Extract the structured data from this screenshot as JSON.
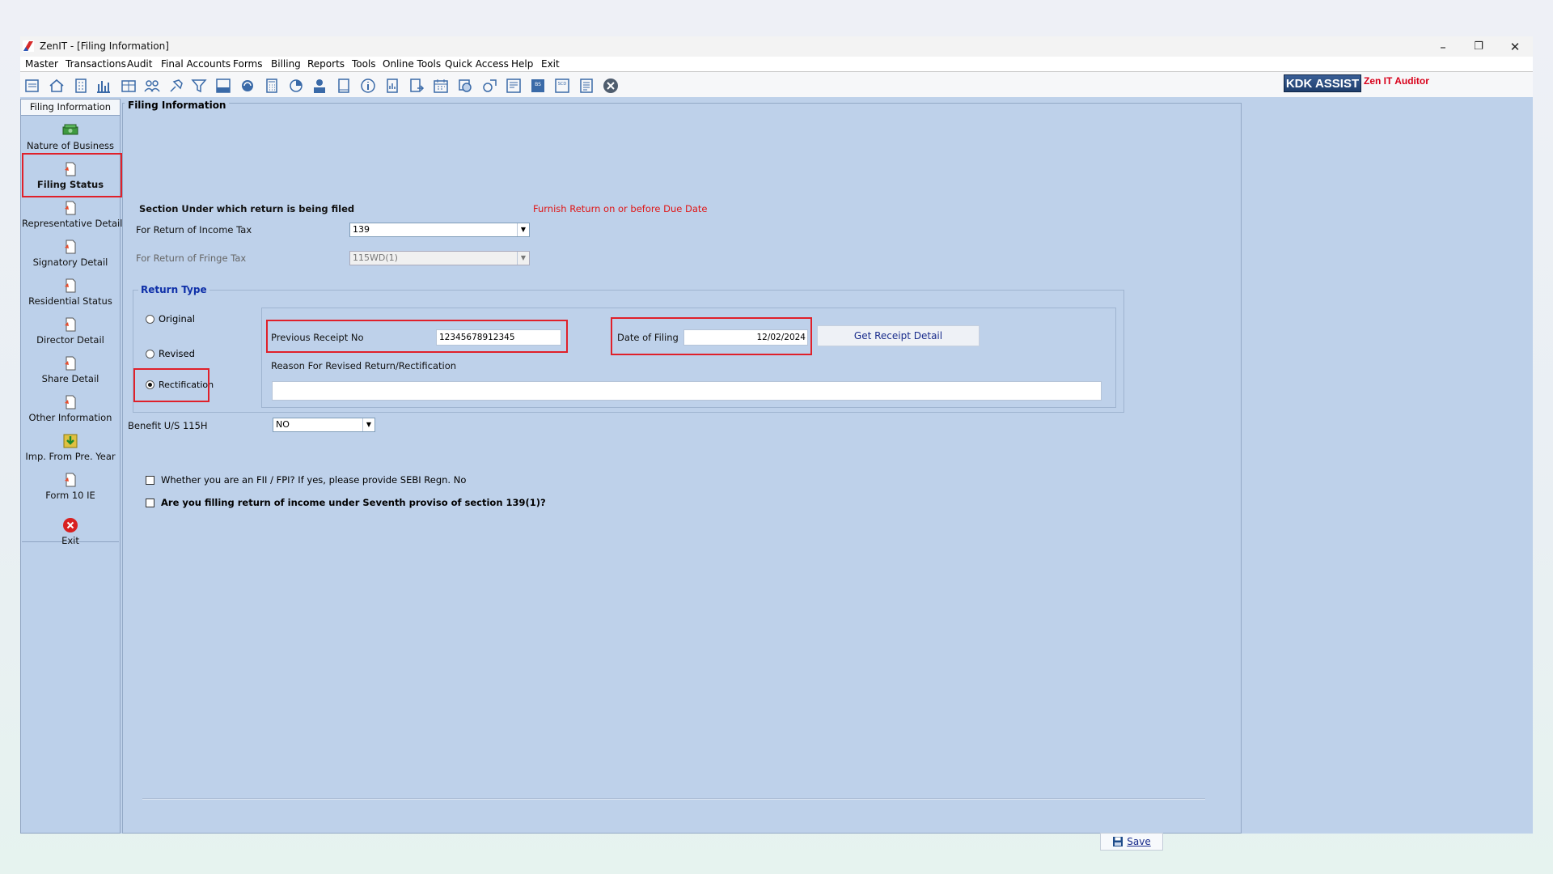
{
  "window": {
    "title": "ZenIT - [Filing Information]",
    "controls": {
      "minimize": "–",
      "restore": "❐",
      "close": "✕"
    }
  },
  "menu": [
    "Master",
    "Transactions",
    "Audit",
    "Final Accounts",
    "Forms",
    "Billing",
    "Reports",
    "Tools",
    "Online Tools",
    "Quick Access",
    "Help",
    "Exit"
  ],
  "toolbar": {
    "icons": [
      "open-icon",
      "home-icon",
      "building-icon",
      "bar-chart-icon",
      "grid-icon",
      "users-icon",
      "pin-icon",
      "filter-icon",
      "tax-icon",
      "refresh-icon",
      "calculator-icon",
      "pie-icon",
      "pay-icon",
      "book-icon",
      "info-icon",
      "report-icon",
      "export-icon",
      "calendar-icon",
      "globe-icon",
      "tools-icon",
      "form-icon",
      "bs-icon",
      "scd-icon",
      "list-icon",
      "close-circle-icon"
    ],
    "brand": "KDK ASSIST",
    "product": "Zen IT Auditor"
  },
  "sidebar": {
    "header": "Filing Information",
    "items": [
      {
        "label": "Nature of Business",
        "icon": "money-icon"
      },
      {
        "label": "Filing Status",
        "icon": "document-icon",
        "active": true
      },
      {
        "label": "Representative Detail",
        "icon": "document-icon"
      },
      {
        "label": "Signatory Detail",
        "icon": "document-icon"
      },
      {
        "label": "Residential Status",
        "icon": "document-icon"
      },
      {
        "label": "Director Detail",
        "icon": "document-icon"
      },
      {
        "label": "Share Detail",
        "icon": "document-icon"
      },
      {
        "label": "Other Information",
        "icon": "document-icon"
      },
      {
        "label": "Imp. From Pre. Year",
        "icon": "import-icon"
      },
      {
        "label": "Form 10 IE",
        "icon": "document-icon"
      },
      {
        "label": "Exit",
        "icon": "exit-icon"
      }
    ]
  },
  "main": {
    "panel_title": "Filing Information",
    "section_heading": "Section Under which return is being filed",
    "due_note": "Furnish Return on or before Due Date",
    "income_tax_label": "For Return of Income Tax",
    "income_tax_value": "139",
    "fringe_tax_label": "For Return of Fringe Tax",
    "fringe_tax_value": "115WD(1)",
    "return_type": {
      "title": "Return Type",
      "options": [
        "Original",
        "Revised",
        "Rectification"
      ],
      "selected": "Rectification"
    },
    "previous_receipt_label": "Previous Receipt No",
    "previous_receipt_value": "12345678912345",
    "date_of_filing_label": "Date of Filing",
    "date_of_filing_value": "12/02/2024",
    "get_receipt_button": "Get Receipt Detail",
    "reason_label": "Reason For Revised Return/Rectification",
    "reason_value": "",
    "benefit_label": "Benefit U/S 115H",
    "benefit_value": "NO",
    "fii_question": "Whether you are an FII / FPI?  If yes, please provide SEBI Regn. No",
    "seventh_proviso_question": "Are you filling return of income under Seventh proviso of section 139(1)?",
    "save_button": "Save"
  }
}
